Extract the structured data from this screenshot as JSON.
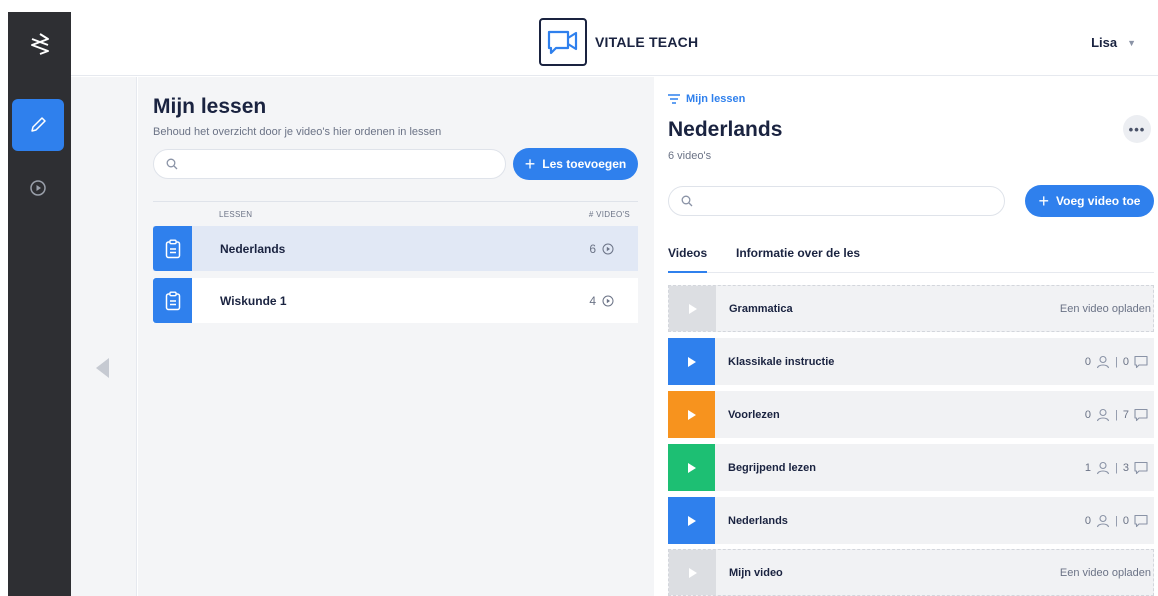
{
  "colors": {
    "accent": "#2f80ed",
    "rail": "#2e2f33",
    "orange": "#f7931e",
    "green": "#1dbf73",
    "empty": "#dcdee2"
  },
  "header": {
    "brand": "VITALE TEACH",
    "user": "Lisa"
  },
  "lessons": {
    "title": "Mijn lessen",
    "subtitle": "Behoud het overzicht door je video's hier ordenen in lessen",
    "search_placeholder": "",
    "add_button": "Les toevoegen",
    "col_lessons": "LESSEN",
    "col_videos": "# VIDEO'S",
    "items": [
      {
        "name": "Nederlands",
        "count": "6"
      },
      {
        "name": "Wiskunde 1",
        "count": "4"
      }
    ]
  },
  "detail": {
    "breadcrumb": "Mijn lessen",
    "title": "Nederlands",
    "subtitle": "6 video's",
    "more": "•••",
    "search_placeholder": "",
    "add_button": "Voeg video toe",
    "tabs": [
      "Videos",
      "Informatie over de les"
    ],
    "videos": [
      {
        "name": "Grammatica",
        "upload": "Een video opladen"
      },
      {
        "name": "Klassikale instructie",
        "viewers": "0",
        "comments": "0"
      },
      {
        "name": "Voorlezen",
        "viewers": "0",
        "comments": "7"
      },
      {
        "name": "Begrijpend lezen",
        "viewers": "1",
        "comments": "3"
      },
      {
        "name": "Nederlands",
        "viewers": "0",
        "comments": "0"
      },
      {
        "name": "Mijn video",
        "upload": "Een video opladen"
      }
    ]
  }
}
